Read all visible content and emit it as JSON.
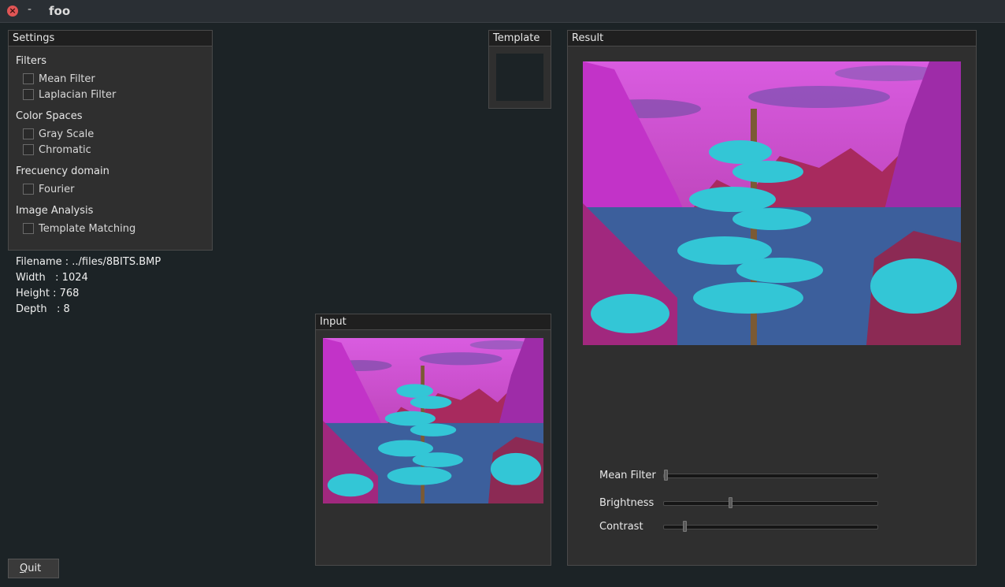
{
  "window": {
    "title": "foo",
    "close_glyph": "×",
    "minimize_glyph": "-"
  },
  "settings": {
    "title": "Settings",
    "sections": [
      {
        "label": "Filters",
        "items": [
          "Mean Filter",
          "Laplacian Filter"
        ]
      },
      {
        "label": "Color Spaces",
        "items": [
          "Gray Scale",
          "Chromatic"
        ]
      },
      {
        "label": "Frecuency domain",
        "items": [
          "Fourier"
        ]
      },
      {
        "label": "Image Analysis",
        "items": [
          "Template Matching"
        ]
      }
    ]
  },
  "file_info": {
    "filename": "Filename : ../files/8BITS.BMP",
    "width": "Width   : 1024",
    "height": "Height : 768",
    "depth": "Depth   : 8"
  },
  "template": {
    "title": "Template"
  },
  "input": {
    "title": "Input"
  },
  "result": {
    "title": "Result",
    "sliders": [
      {
        "label": "Mean Filter",
        "value": 0.0
      },
      {
        "label": "Brightness",
        "value": 0.31
      },
      {
        "label": "Contrast",
        "value": 0.09
      }
    ]
  },
  "quit": {
    "prefix": "Q",
    "rest": "uit"
  },
  "colors": {
    "sky": "#c24ad0",
    "mountain": "#b0246a",
    "water": "#3a5f9a",
    "tree": "#30c8d8"
  },
  "icons": {
    "close": "close-icon",
    "minimize": "minimize-icon"
  }
}
